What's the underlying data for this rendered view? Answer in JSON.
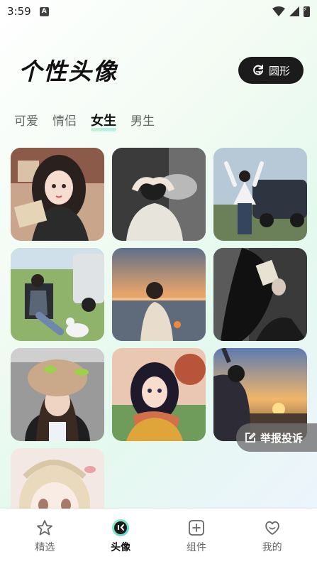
{
  "status_bar": {
    "time": "3:59",
    "app_icon": "A"
  },
  "header": {
    "title": "个性头像",
    "shape_button_label": "圆形"
  },
  "tabs": [
    {
      "label": "可爱",
      "active": false
    },
    {
      "label": "情侣",
      "active": false
    },
    {
      "label": "女生",
      "active": true
    },
    {
      "label": "男生",
      "active": false
    }
  ],
  "gallery": [
    {
      "name": "anime-girl-with-book"
    },
    {
      "name": "girl-back-hands-on-head"
    },
    {
      "name": "girl-arms-up-by-suv"
    },
    {
      "name": "girl-sitting-by-car-with-dog"
    },
    {
      "name": "girl-at-sunset-beach"
    },
    {
      "name": "girl-dark-hair-covering-face"
    },
    {
      "name": "girl-in-fuzzy-hat"
    },
    {
      "name": "anime-girl-scarf"
    },
    {
      "name": "girl-sunset-silhouette"
    },
    {
      "name": "anime-girl-sketch"
    }
  ],
  "report_button_label": "举报投诉",
  "bottom_nav": [
    {
      "label": "精选",
      "icon": "star-icon",
      "active": false
    },
    {
      "label": "头像",
      "icon": "avatar-face-icon",
      "active": true
    },
    {
      "label": "组件",
      "icon": "plus-square-icon",
      "active": false
    },
    {
      "label": "我的",
      "icon": "heart-face-icon",
      "active": false
    }
  ],
  "colors": {
    "accent": "#b9f0cf",
    "button_dark": "#1b1b1b"
  }
}
